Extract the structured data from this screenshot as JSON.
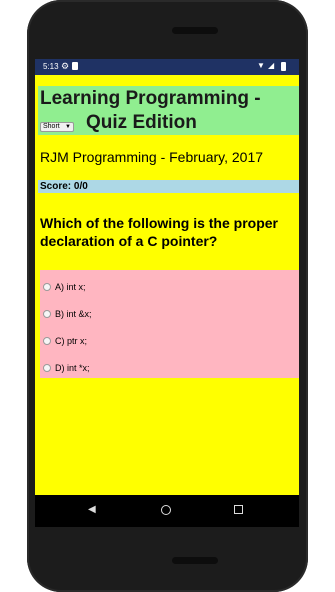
{
  "status_bar": {
    "time": "5:13",
    "icons": [
      "gear-icon",
      "sd-card-icon",
      "wifi-icon",
      "signal-icon",
      "battery-icon"
    ]
  },
  "header": {
    "title_line1": "Learning Programming -",
    "title_line2": "Quiz Edition",
    "mode_select": {
      "selected": "Short"
    }
  },
  "byline": "RJM Programming - February, 2017",
  "score": "Score: 0/0",
  "question": "Which of the following is the proper declaration of a C pointer?",
  "options": [
    {
      "label": "A) int x;"
    },
    {
      "label": "B) int &x;"
    },
    {
      "label": "C) ptr x;"
    },
    {
      "label": "D) int *x;"
    }
  ],
  "colors": {
    "page_background": "#ffff00",
    "header_background": "#90ee90",
    "score_background": "#add8e6",
    "options_background": "#ffb6c1",
    "statusbar": "#1f3264"
  }
}
